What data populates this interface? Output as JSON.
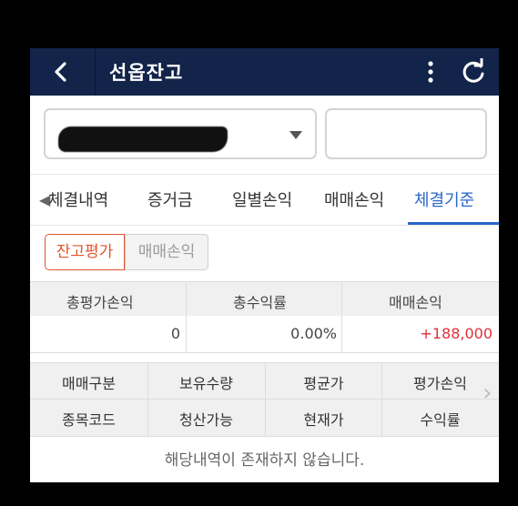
{
  "header": {
    "title": "선옵잔고"
  },
  "account": {
    "selected": ""
  },
  "tabs": [
    "체결내역",
    "증거금",
    "일별손익",
    "매매손익",
    "체결기준"
  ],
  "segments": [
    "잔고평가",
    "매매손익"
  ],
  "summary": {
    "headers": [
      "총평가손익",
      "총수익률",
      "매매손익"
    ],
    "values": [
      "0",
      "0.00%",
      "+188,000"
    ]
  },
  "grid_headers": {
    "row1": [
      "매매구분",
      "보유수량",
      "평균가",
      "평가손익"
    ],
    "row2": [
      "종목코드",
      "청산가능",
      "현재가",
      "수익률"
    ]
  },
  "empty_message": "해당내역이 존재하지 않습니다.",
  "colors": {
    "header_bg": "#12244a",
    "active_tab": "#2a67c8",
    "accent_orange": "#e0552f",
    "profit_red": "#e0303a"
  }
}
